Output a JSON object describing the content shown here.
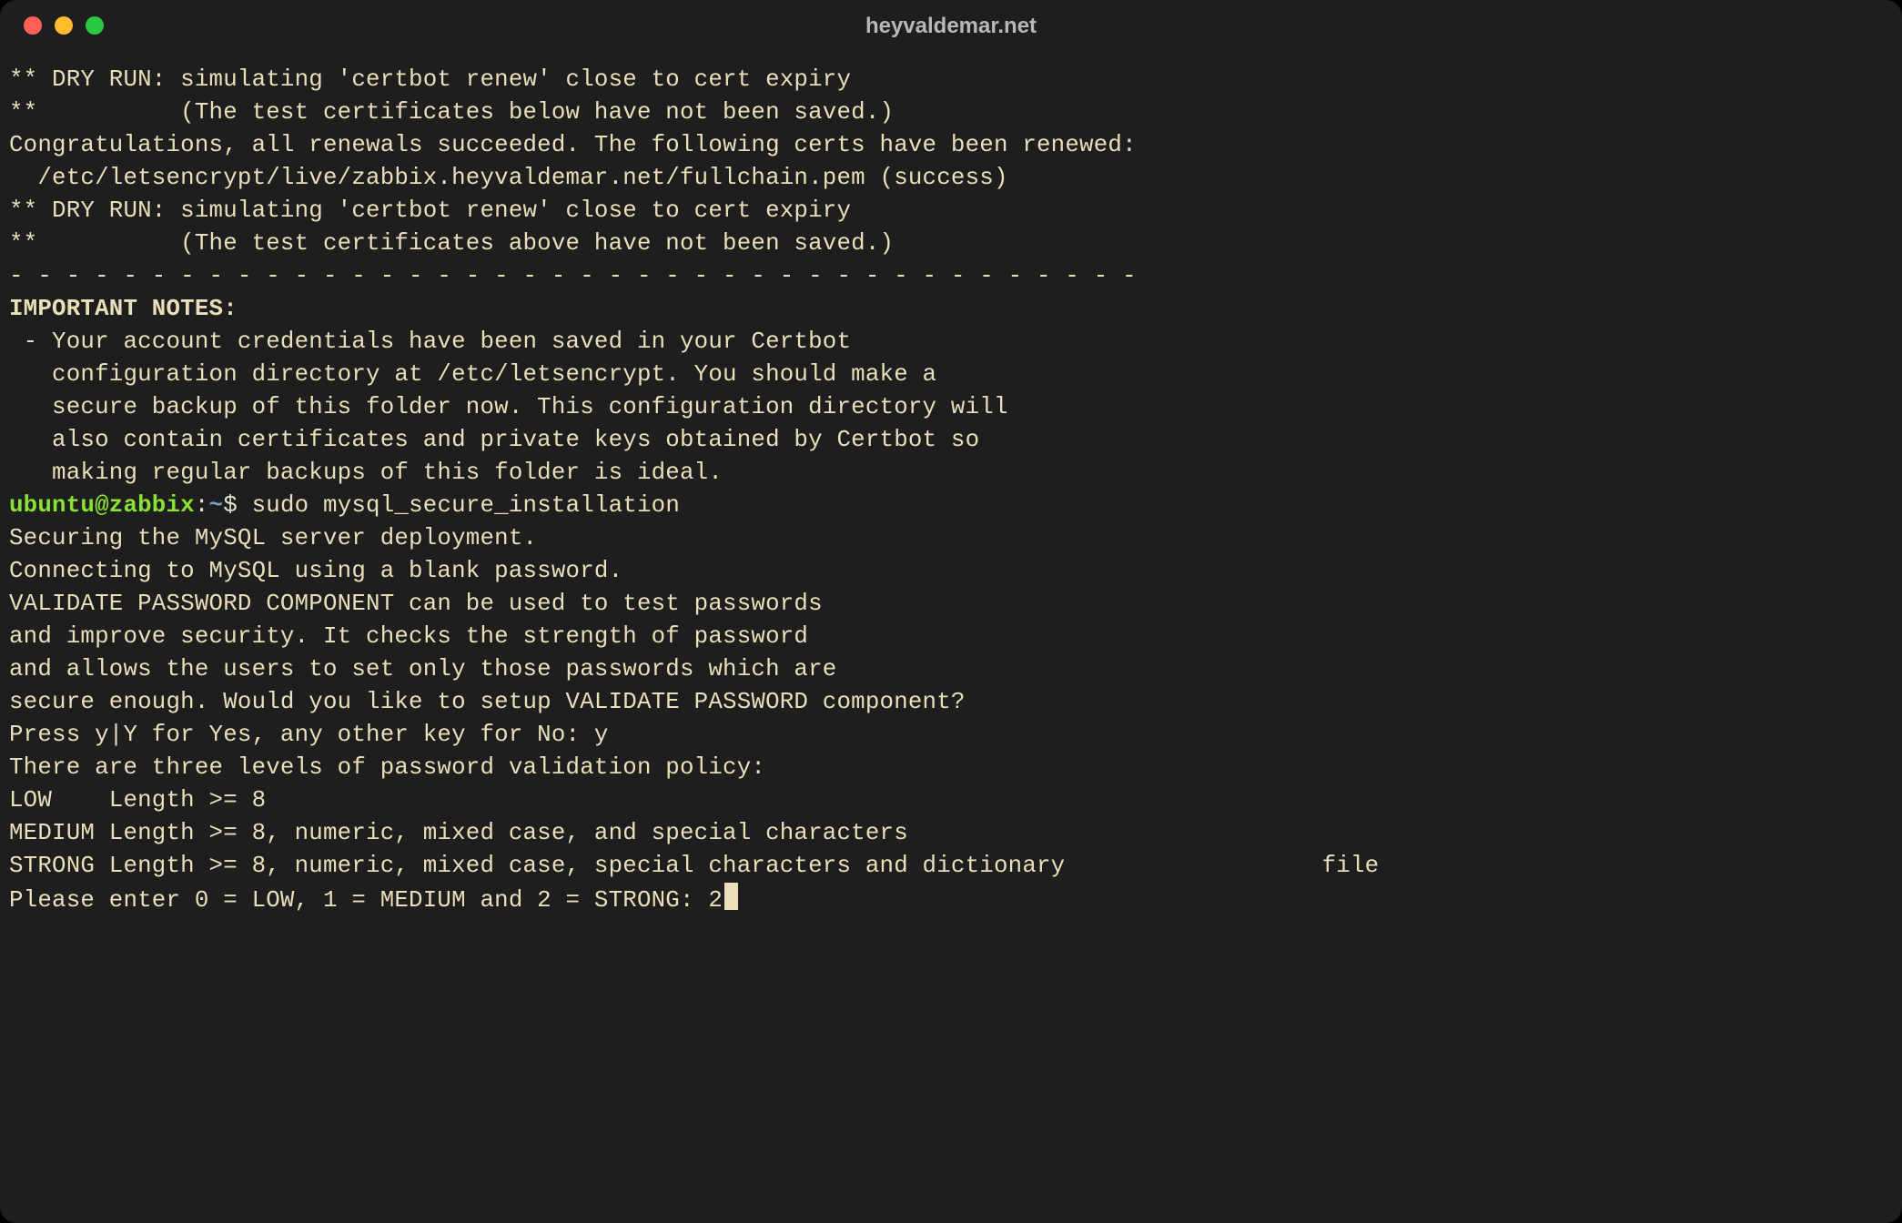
{
  "window": {
    "title": "heyvaldemar.net"
  },
  "terminal": {
    "lines": {
      "l0": "** DRY RUN: simulating 'certbot renew' close to cert expiry",
      "l1": "**          (The test certificates below have not been saved.)",
      "l2": "",
      "l3": "Congratulations, all renewals succeeded. The following certs have been renewed:",
      "l4": "  /etc/letsencrypt/live/zabbix.heyvaldemar.net/fullchain.pem (success)",
      "l5": "** DRY RUN: simulating 'certbot renew' close to cert expiry",
      "l6": "**          (The test certificates above have not been saved.)",
      "l7": "- - - - - - - - - - - - - - - - - - - - - - - - - - - - - - - - - - - - - - - -",
      "l8": "",
      "l9": "IMPORTANT NOTES:",
      "l10": " - Your account credentials have been saved in your Certbot",
      "l11": "   configuration directory at /etc/letsencrypt. You should make a",
      "l12": "   secure backup of this folder now. This configuration directory will",
      "l13": "   also contain certificates and private keys obtained by Certbot so",
      "l14": "   making regular backups of this folder is ideal.",
      "l16": "",
      "l17": "Securing the MySQL server deployment.",
      "l18": "",
      "l19": "Connecting to MySQL using a blank password.",
      "l20": "",
      "l21": "VALIDATE PASSWORD COMPONENT can be used to test passwords",
      "l22": "and improve security. It checks the strength of password",
      "l23": "and allows the users to set only those passwords which are",
      "l24": "secure enough. Would you like to setup VALIDATE PASSWORD component?",
      "l25": "",
      "l26": "Press y|Y for Yes, any other key for No: y",
      "l27": "",
      "l28": "There are three levels of password validation policy:",
      "l29": "",
      "l30": "LOW    Length >= 8",
      "l31": "MEDIUM Length >= 8, numeric, mixed case, and special characters",
      "l32": "STRONG Length >= 8, numeric, mixed case, special characters and dictionary                  file",
      "l33": "",
      "l34": "Please enter 0 = LOW, 1 = MEDIUM and 2 = STRONG: 2"
    },
    "prompt": {
      "user": "ubuntu@zabbix",
      "sep1": ":",
      "path": "~",
      "sep2": "$ ",
      "command": "sudo mysql_secure_installation"
    }
  }
}
